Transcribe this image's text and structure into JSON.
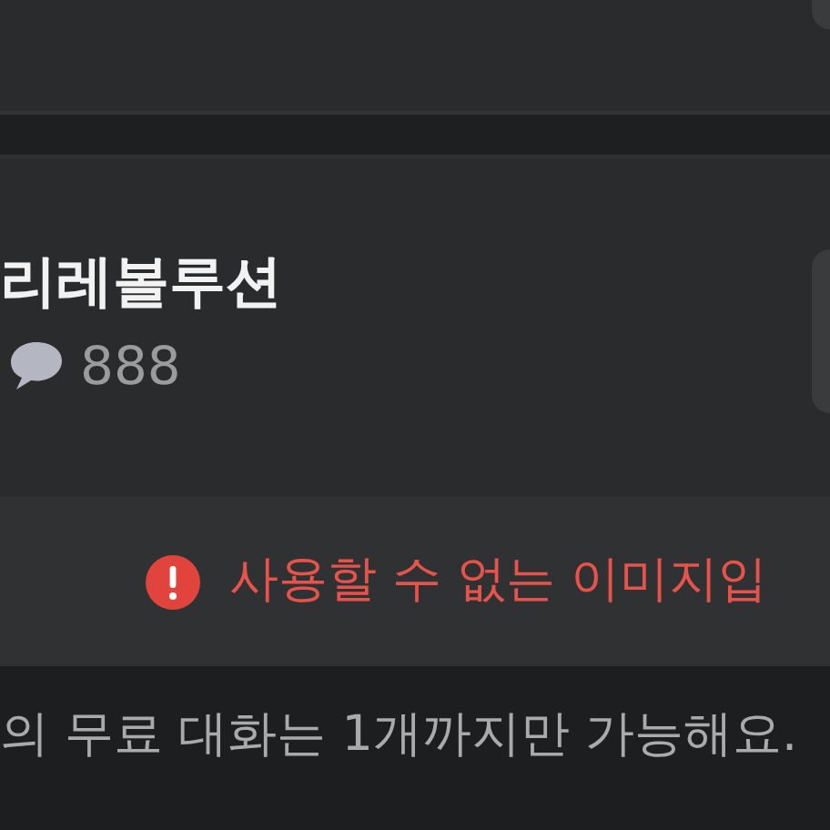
{
  "post": {
    "title": "리레볼루션",
    "comment_count": "888"
  },
  "error_notice": {
    "text": "사용할 수 없는 이미지입"
  },
  "footer_note": "의 무료 대화는 1개까지만 가능해요."
}
